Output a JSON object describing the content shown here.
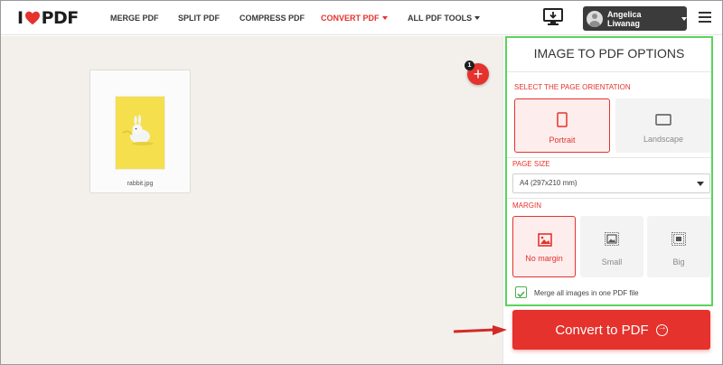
{
  "brand": {
    "logo_left": "I",
    "logo_right": "PDF",
    "accent": "#e5322d"
  },
  "nav": [
    {
      "label": "MERGE PDF"
    },
    {
      "label": "SPLIT PDF"
    },
    {
      "label": "COMPRESS PDF"
    },
    {
      "label": "CONVERT PDF",
      "active": true,
      "has_dropdown": true
    },
    {
      "label": "ALL PDF TOOLS",
      "has_dropdown": true
    }
  ],
  "header": {
    "user_name": "Angelica Liwanag",
    "desktop_icon": "monitor-download-icon",
    "menu_icon": "hamburger-icon"
  },
  "workspace": {
    "file": {
      "name": "rabbit.jpg"
    },
    "add_badge_count": "1",
    "add_button_icon": "plus-icon"
  },
  "options": {
    "title": "IMAGE TO PDF OPTIONS",
    "orientation": {
      "label": "SELECT THE PAGE ORIENTATION",
      "items": [
        {
          "label": "Portrait",
          "selected": true
        },
        {
          "label": "Landscape",
          "selected": false
        }
      ]
    },
    "page_size": {
      "label": "PAGE SIZE",
      "value": "A4 (297x210 mm)"
    },
    "margin": {
      "label": "MARGIN",
      "items": [
        {
          "label": "No margin",
          "selected": true
        },
        {
          "label": "Small",
          "selected": false
        },
        {
          "label": "Big",
          "selected": false
        }
      ]
    },
    "merge": {
      "label": "Merge all images in one PDF file",
      "checked": true
    },
    "convert_label": "Convert to PDF"
  }
}
